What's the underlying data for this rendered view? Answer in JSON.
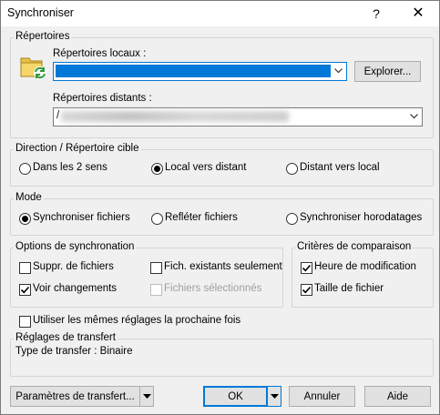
{
  "window": {
    "title": "Synchroniser",
    "help_glyph": "?",
    "close_glyph": "✕"
  },
  "directories": {
    "legend": "Répertoires",
    "local_label": "Répertoires locaux :",
    "local_value": "",
    "browse_button": "Explorer...",
    "remote_label": "Répertoires distants :",
    "remote_value": "/"
  },
  "direction": {
    "legend": "Direction / Répertoire cible",
    "options": [
      "Dans les 2 sens",
      "Local vers distant",
      "Distant vers local"
    ],
    "selected": "Local vers distant"
  },
  "mode": {
    "legend": "Mode",
    "options": [
      "Synchroniser fichiers",
      "Refléter fichiers",
      "Synchroniser horodatages"
    ],
    "selected": "Synchroniser fichiers"
  },
  "sync_options": {
    "legend": "Options de synchronation",
    "delete_files": {
      "label": "Suppr. de fichiers",
      "checked": false
    },
    "existing_only": {
      "label": "Fich. existants seulement",
      "checked": false
    },
    "preview_changes": {
      "label": "Voir changements",
      "checked": true
    },
    "selected_files": {
      "label": "Fichiers sélectionnés",
      "checked": false,
      "disabled": true
    }
  },
  "comparison": {
    "legend": "Critères de comparaison",
    "mod_time": {
      "label": "Heure de modification",
      "checked": true
    },
    "file_size": {
      "label": "Taille de fichier",
      "checked": true
    }
  },
  "reuse_settings": {
    "label": "Utiliser les mêmes réglages la prochaine fois",
    "checked": false
  },
  "transfer_settings": {
    "legend": "Réglages de transfert",
    "text": "Type de transfer : Binaire"
  },
  "footer": {
    "transfer_params_button": "Paramètres de transfert...",
    "ok_button": "OK",
    "cancel_button": "Annuler",
    "help_button": "Aide"
  },
  "colors": {
    "accent": "#0078d7",
    "window_bg": "#f0f0f0",
    "group_border": "#d5d5d5"
  }
}
